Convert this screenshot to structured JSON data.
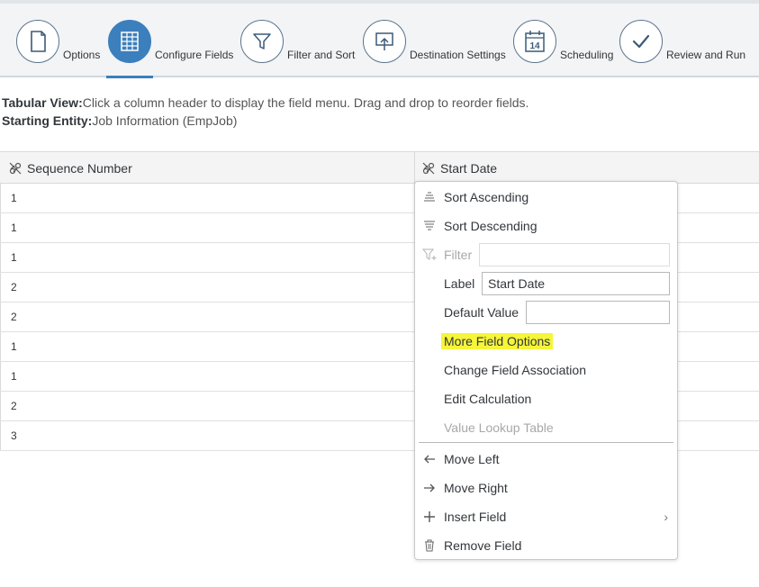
{
  "wizard": {
    "steps": [
      {
        "label": "Options",
        "icon": "document-icon"
      },
      {
        "label": "Configure Fields",
        "icon": "grid-icon",
        "active": true
      },
      {
        "label": "Filter and Sort",
        "icon": "funnel-icon"
      },
      {
        "label": "Destination Settings",
        "icon": "upload-icon"
      },
      {
        "label": "Scheduling",
        "icon": "calendar-icon",
        "calendar_day": "14"
      },
      {
        "label": "Review and Run",
        "icon": "checkmark-icon"
      }
    ],
    "accent_color": "#3c7fbd"
  },
  "info": {
    "tabular_label": "Tabular View:",
    "tabular_text": "Click a column header to display the field menu. Drag and drop to reorder fields.",
    "entity_label": "Starting Entity:",
    "entity_text": "Job Information (EmpJob)"
  },
  "table": {
    "columns": [
      "Sequence Number",
      "Start Date"
    ],
    "rows": [
      "1",
      "1",
      "1",
      "2",
      "2",
      "1",
      "1",
      "2",
      "3"
    ]
  },
  "menu": {
    "sort_ascending": "Sort Ascending",
    "sort_descending": "Sort Descending",
    "filter_label": "Filter",
    "filter_value": "",
    "label_label": "Label",
    "label_value": "Start Date",
    "default_value_label": "Default Value",
    "default_value_value": "",
    "more_field_options": "More Field Options",
    "change_field_association": "Change Field Association",
    "edit_calculation": "Edit Calculation",
    "value_lookup_table": "Value Lookup Table",
    "move_left": "Move Left",
    "move_right": "Move Right",
    "insert_field": "Insert Field",
    "remove_field": "Remove Field",
    "highlight_color": "#f5f53a"
  }
}
